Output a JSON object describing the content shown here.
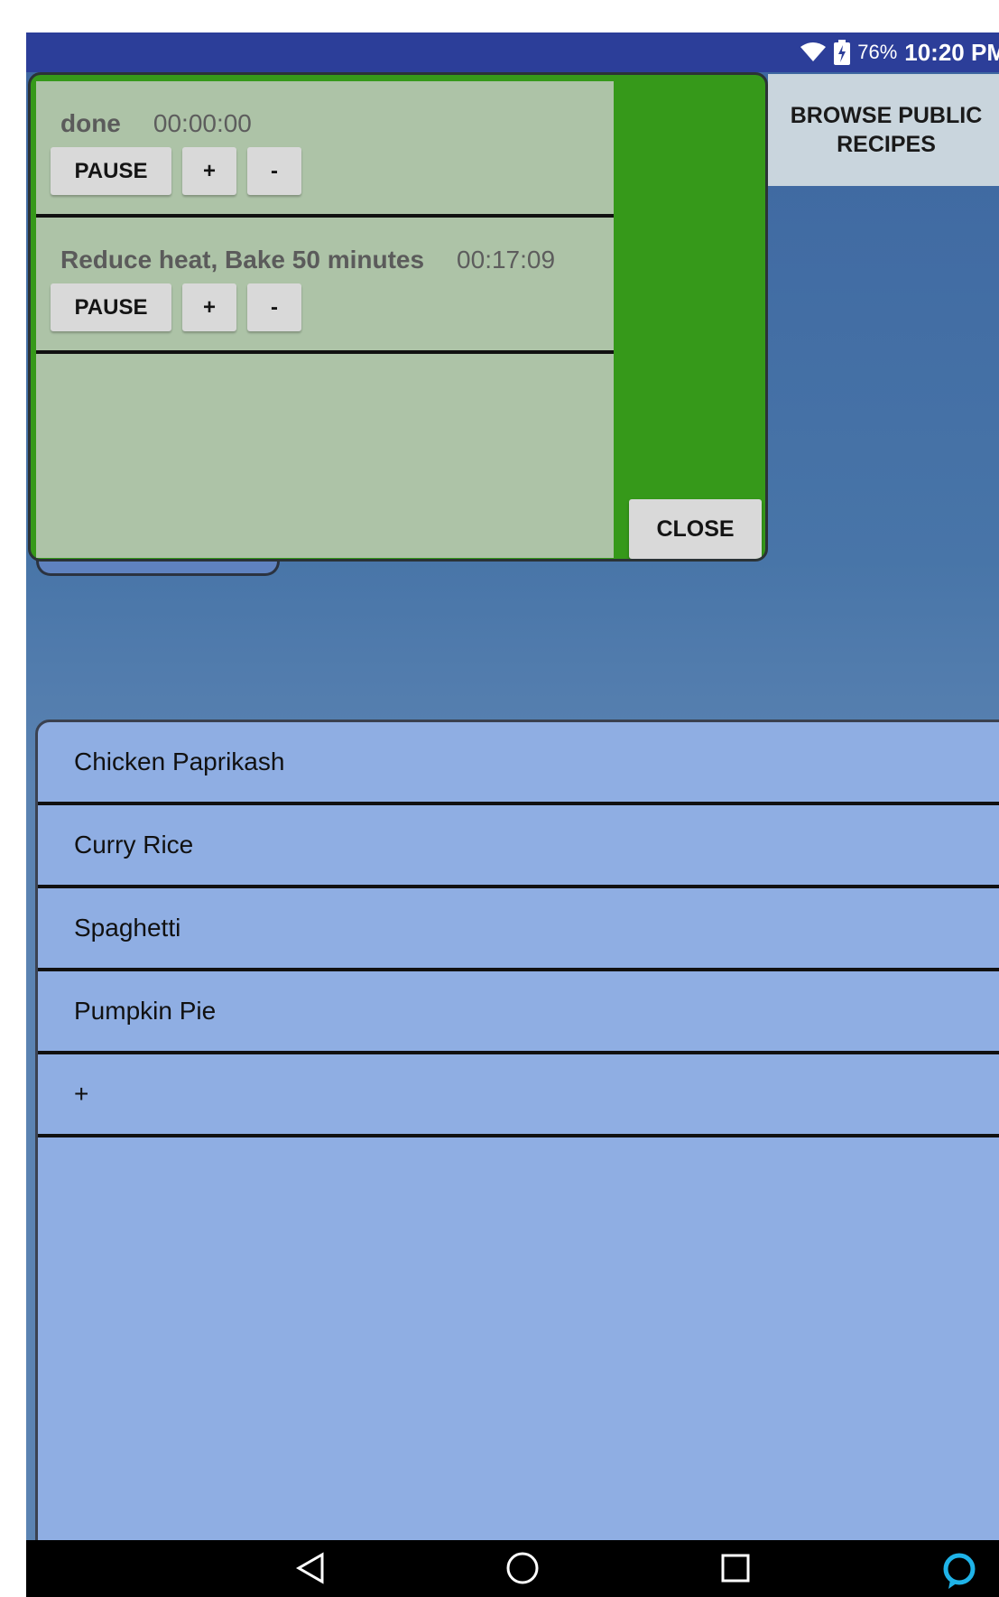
{
  "status_bar": {
    "battery_percent": "76%",
    "time": "10:20 PM",
    "wifi_icon": "wifi-icon",
    "battery_icon": "battery-charging-icon"
  },
  "header": {
    "browse_label": "BROWSE PUBLIC RECIPES"
  },
  "timers": {
    "items": [
      {
        "name": "done",
        "time": "00:00:00",
        "pause_label": "PAUSE",
        "plus_label": "+",
        "minus_label": "-"
      },
      {
        "name": "Reduce heat, Bake 50 minutes",
        "time": "00:17:09",
        "pause_label": "PAUSE",
        "plus_label": "+",
        "minus_label": "-"
      }
    ],
    "close_label": "CLOSE"
  },
  "recipes": {
    "items": [
      {
        "label": "Chicken Paprikash"
      },
      {
        "label": "Curry Rice"
      },
      {
        "label": "Spaghetti"
      },
      {
        "label": "Pumpkin Pie"
      },
      {
        "label": "+"
      }
    ]
  },
  "nav_bar": {
    "icons": [
      "back-icon",
      "home-icon",
      "recents-icon",
      "alexa-icon"
    ]
  },
  "colors": {
    "status_bar": "#2c3e99",
    "timer_panel": "#36991a",
    "timer_list": "#adc3a7",
    "recipe_list": "#8faee3",
    "browse_button": "#c9d5dd"
  }
}
